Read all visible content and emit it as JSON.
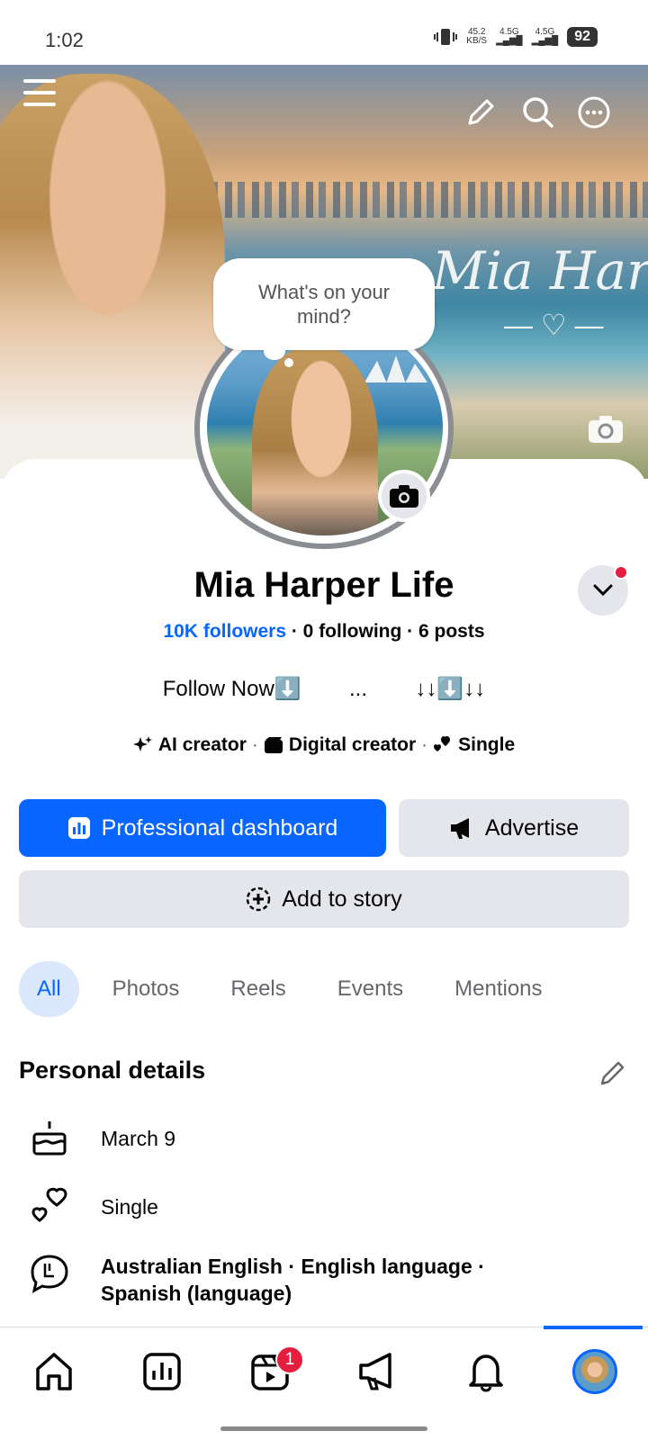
{
  "status_bar": {
    "time": "1:02",
    "net_speed": "45.2",
    "net_unit": "KB/S",
    "signal1": "4.5G",
    "signal2": "4.5G",
    "battery": "92"
  },
  "cover": {
    "script_text": "Mia Harper",
    "icons": [
      "menu-icon",
      "pencil-icon",
      "search-icon",
      "more-icon",
      "camera-icon"
    ]
  },
  "bubble": {
    "text": "What's on your mind?"
  },
  "profile": {
    "name": "Mia Harper Life",
    "followers": "10K followers",
    "following": " · 0 following · 6 posts",
    "bio": "Follow Now⬇️        ...        ↓↓⬇️↓↓"
  },
  "tags": [
    {
      "label": "AI creator",
      "icon": "sparkle-icon"
    },
    {
      "label": "Digital creator",
      "icon": "clapper-icon"
    },
    {
      "label": "Single",
      "icon": "hearts-icon"
    }
  ],
  "buttons": {
    "dashboard": "Professional dashboard",
    "advertise": "Advertise",
    "story": "Add to story"
  },
  "tabs": [
    "All",
    "Photos",
    "Reels",
    "Events",
    "Mentions"
  ],
  "personal_details": {
    "title": "Personal details",
    "birthday": "March 9",
    "relationship": "Single",
    "languages": "Australian English · English language · Spanish (language)"
  },
  "bottom_nav": {
    "items": [
      "home-icon",
      "dashboard-icon",
      "reels-icon",
      "megaphone-icon",
      "bell-icon",
      "profile-avatar"
    ],
    "reels_badge": "1"
  },
  "colors": {
    "accent": "#0866ff",
    "badge": "#e41e3f",
    "button_grey": "#e4e6eb"
  }
}
